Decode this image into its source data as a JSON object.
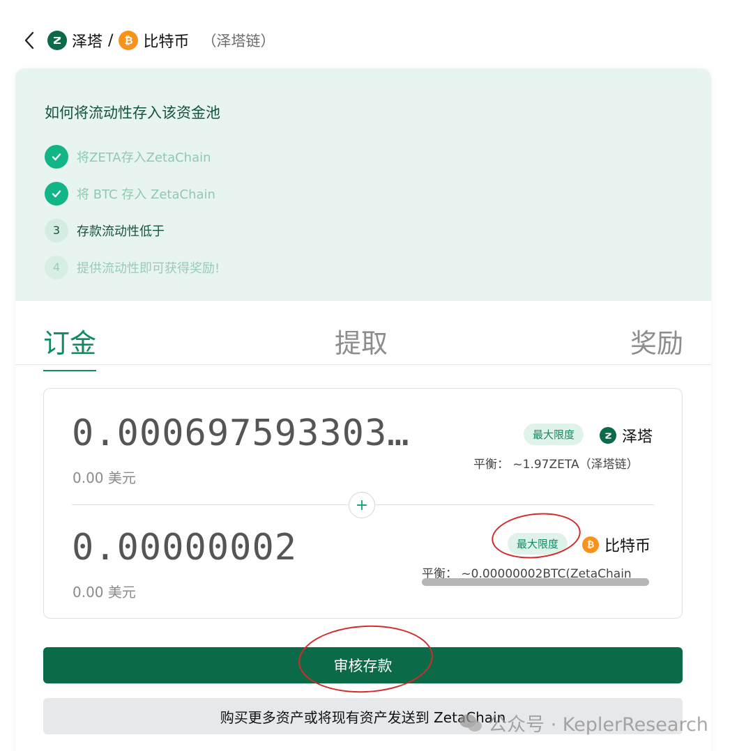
{
  "header": {
    "pair_token_a": "泽塔",
    "pair_separator": "/",
    "pair_token_b": "比特币",
    "chain": "（泽塔链）"
  },
  "steps": {
    "title": "如何将流动性存入该资金池",
    "items": [
      {
        "label": "将ZETA存入ZetaChain",
        "state": "done"
      },
      {
        "label": "将 BTC 存入 ZetaChain",
        "state": "done"
      },
      {
        "label": "存款流动性低于",
        "state": "current",
        "number": "3"
      },
      {
        "label": "提供流动性即可获得奖励!",
        "state": "todo",
        "number": "4"
      }
    ]
  },
  "tabs": [
    "订金",
    "提取",
    "奖励"
  ],
  "inputs": {
    "top": {
      "amount": "0.000697593303…",
      "usd": "0.00 美元",
      "max_label": "最大限度",
      "token": "泽塔",
      "balance": "平衡：  ~1.97ZETA（泽塔链）"
    },
    "bottom": {
      "amount": "0.00000002",
      "usd": "0.00 美元",
      "max_label": "最大限度",
      "token": "比特币",
      "balance": "平衡：  ~0.00000002BTC(ZetaChain"
    },
    "plus_symbol": "+"
  },
  "buttons": {
    "review": "审核存款",
    "buy_more": "购买更多资产或将现有资产发送到 ZetaChain"
  },
  "watermark": "公众号 · KeplerResearch",
  "colors": {
    "brand_green": "#0b6b48",
    "accent_green": "#0f8a63",
    "btc_orange": "#f7931a",
    "annotation_red": "#d42a2a"
  },
  "icons": [
    "back-chevron-icon",
    "zeta-logo-icon",
    "btc-logo-icon",
    "check-icon",
    "plus-icon",
    "wechat-icon"
  ]
}
